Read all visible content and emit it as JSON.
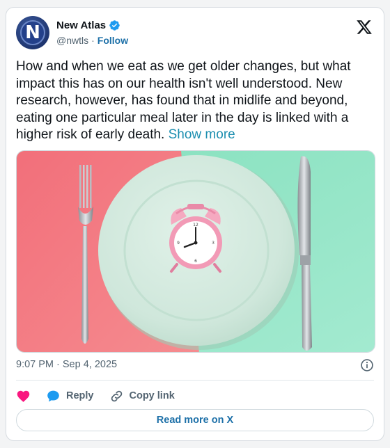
{
  "account": {
    "display_name": "New Atlas",
    "handle": "@nwtls",
    "separator": "·",
    "follow_label": "Follow",
    "avatar_letter": "N"
  },
  "tweet": {
    "text": "How and when we eat as we get older changes, but what impact this has on our health isn't well understood. New research, however, has found that in midlife and beyond, eating one particular meal later in the day is linked with a higher risk of early death.",
    "show_more": "Show more",
    "timestamp": "9:07 PM · Sep 4, 2025"
  },
  "actions": {
    "reply_label": "Reply",
    "copy_link_label": "Copy link",
    "read_more_label": "Read more on X"
  },
  "icons": {
    "verified": "verified-badge-icon",
    "brand": "x-logo-icon",
    "info": "info-icon",
    "like": "heart-icon",
    "reply": "reply-bubble-icon",
    "copy": "link-icon"
  },
  "colors": {
    "link": "#1d70a8",
    "verified": "#1d9bf0",
    "heart": "#f91880",
    "media_left": "#f3737c",
    "media_right": "#8fe3c3",
    "plate": "#d4ebe0",
    "clock": "#f29ab6"
  }
}
